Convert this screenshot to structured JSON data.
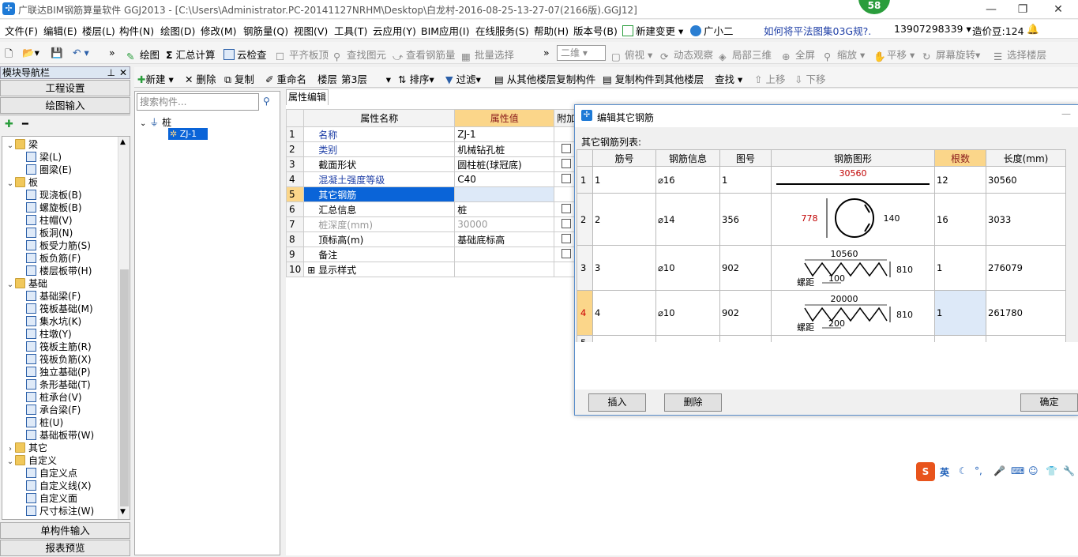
{
  "titlebar": {
    "title": "广联达BIM钢筋算量软件 GGJ2013 - [C:\\Users\\Administrator.PC-20141127NRHM\\Desktop\\白龙村-2016-08-25-13-27-07(2166版).GGJ12]",
    "badge": "58"
  },
  "menu": {
    "items": [
      "文件(F)",
      "编辑(E)",
      "楼层(L)",
      "构件(N)",
      "绘图(D)",
      "修改(M)",
      "钢筋量(Q)",
      "视图(V)",
      "工具(T)",
      "云应用(Y)",
      "BIM应用(I)",
      "在线服务(S)",
      "帮助(H)",
      "版本号(B)",
      "新建变更",
      "广小二"
    ],
    "news": "如何将平法图集03G规?.",
    "phone": "13907298339",
    "beans": "造价豆:124"
  },
  "toolbar": {
    "items": [
      "绘图",
      "汇总计算",
      "云检查",
      "平齐板顶",
      "查找图元",
      "查看钢筋量",
      "批量选择",
      "二维",
      "俯视",
      "动态观察",
      "局部三维",
      "全屏",
      "缩放",
      "平移",
      "屏幕旋转",
      "选择楼层"
    ]
  },
  "toolbar2": {
    "new": "新建",
    "delete": "删除",
    "copy": "复制",
    "rename": "重命名",
    "floor_label": "楼层",
    "floor_value": "第3层",
    "sort": "排序",
    "filter": "过滤",
    "copy_from": "从其他楼层复制构件",
    "copy_to": "复制构件到其他楼层",
    "find": "查找",
    "up": "上移",
    "down": "下移"
  },
  "nav": {
    "header": "模块导航栏",
    "project_settings": "工程设置",
    "drawing_input": "绘图输入",
    "single_input": "单构件输入",
    "report_preview": "报表预览"
  },
  "tree": [
    {
      "label": "梁",
      "level": 0,
      "folder": true
    },
    {
      "label": "梁(L)",
      "level": 1
    },
    {
      "label": "圈梁(E)",
      "level": 1
    },
    {
      "label": "板",
      "level": 0,
      "folder": true
    },
    {
      "label": "现浇板(B)",
      "level": 1
    },
    {
      "label": "螺旋板(B)",
      "level": 1
    },
    {
      "label": "柱帽(V)",
      "level": 1
    },
    {
      "label": "板洞(N)",
      "level": 1
    },
    {
      "label": "板受力筋(S)",
      "level": 1
    },
    {
      "label": "板负筋(F)",
      "level": 1
    },
    {
      "label": "楼层板带(H)",
      "level": 1
    },
    {
      "label": "基础",
      "level": 0,
      "folder": true
    },
    {
      "label": "基础梁(F)",
      "level": 1
    },
    {
      "label": "筏板基础(M)",
      "level": 1
    },
    {
      "label": "集水坑(K)",
      "level": 1
    },
    {
      "label": "柱墩(Y)",
      "level": 1
    },
    {
      "label": "筏板主筋(R)",
      "level": 1
    },
    {
      "label": "筏板负筋(X)",
      "level": 1
    },
    {
      "label": "独立基础(P)",
      "level": 1
    },
    {
      "label": "条形基础(T)",
      "level": 1
    },
    {
      "label": "桩承台(V)",
      "level": 1
    },
    {
      "label": "承台梁(F)",
      "level": 1
    },
    {
      "label": "桩(U)",
      "level": 1
    },
    {
      "label": "基础板带(W)",
      "level": 1
    },
    {
      "label": "其它",
      "level": 0,
      "folder": true
    },
    {
      "label": "自定义",
      "level": 0,
      "folder": true
    },
    {
      "label": "自定义点",
      "level": 1
    },
    {
      "label": "自定义线(X)",
      "level": 1
    },
    {
      "label": "自定义面",
      "level": 1
    },
    {
      "label": "尺寸标注(W)",
      "level": 1
    }
  ],
  "components": {
    "search_placeholder": "搜索构件...",
    "root": "桩",
    "child": "ZJ-1"
  },
  "props": {
    "tab": "属性编辑",
    "col_name": "属性名称",
    "col_value": "属性值",
    "col_extra": "附加",
    "rows": [
      {
        "n": "1",
        "name": "名称",
        "value": "ZJ-1"
      },
      {
        "n": "2",
        "name": "类别",
        "value": "机械钻孔桩"
      },
      {
        "n": "3",
        "name": "截面形状",
        "value": "圆柱桩(球冠底)"
      },
      {
        "n": "4",
        "name": "混凝土强度等级",
        "value": "C40"
      },
      {
        "n": "5",
        "name": "其它钢筋",
        "value": ""
      },
      {
        "n": "6",
        "name": "汇总信息",
        "value": "桩"
      },
      {
        "n": "7",
        "name": "桩深度(mm)",
        "value": "30000"
      },
      {
        "n": "8",
        "name": "顶标高(m)",
        "value": "基础底标高"
      },
      {
        "n": "9",
        "name": "备注",
        "value": ""
      },
      {
        "n": "10",
        "name": "显示样式",
        "value": ""
      }
    ]
  },
  "dialog": {
    "title": "编辑其它钢筋",
    "list_label": "其它钢筋列表:",
    "headers": [
      "筋号",
      "钢筋信息",
      "图号",
      "钢筋图形",
      "根数",
      "长度(mm)"
    ],
    "rows": [
      {
        "n": "1",
        "bar": "1",
        "info": "⌀16",
        "fig": "1",
        "count": "12",
        "length": "30560",
        "shape_label": "30560"
      },
      {
        "n": "2",
        "bar": "2",
        "info": "⌀14",
        "fig": "356",
        "count": "16",
        "length": "3033",
        "shape_a": "778",
        "shape_b": "140"
      },
      {
        "n": "3",
        "bar": "3",
        "info": "⌀10",
        "fig": "902",
        "count": "1",
        "length": "276079",
        "shape_top": "10560",
        "shape_right": "810",
        "shape_left": "螺距",
        "shape_pitch": "100"
      },
      {
        "n": "4",
        "bar": "4",
        "info": "⌀10",
        "fig": "902",
        "count": "1",
        "length": "261780",
        "shape_top": "20000",
        "shape_right": "810",
        "shape_left": "螺距",
        "shape_pitch": "200"
      },
      {
        "n": "5",
        "bar": "",
        "info": "",
        "fig": "",
        "count": "",
        "length": ""
      }
    ],
    "insert": "插入",
    "delete": "删除",
    "ok": "确定"
  },
  "ime": {
    "label": "英"
  },
  "colors": {
    "accent": "#0a64d8",
    "header_highlight": "#fbd68a",
    "red": "#c00000"
  }
}
